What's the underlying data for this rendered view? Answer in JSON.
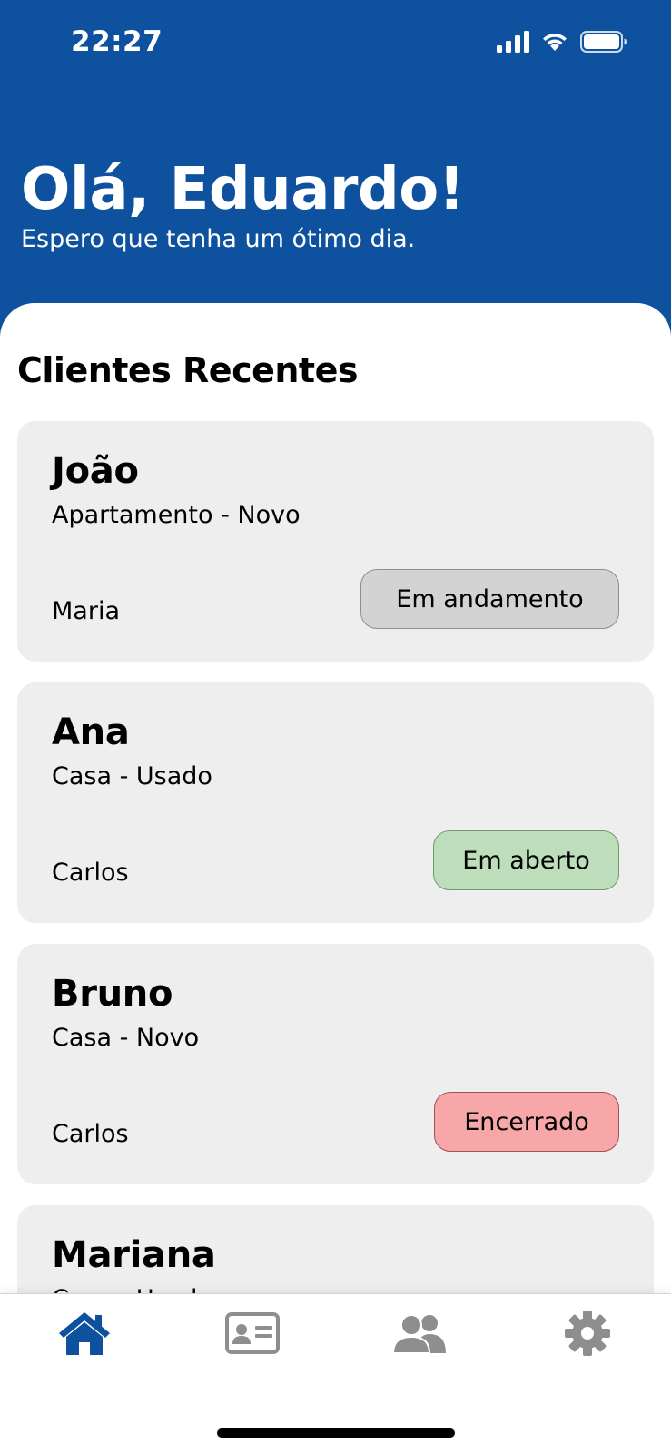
{
  "status_bar": {
    "time": "22:27"
  },
  "header": {
    "greeting": "Olá, Eduardo!",
    "subtitle": "Espero que tenha um ótimo dia."
  },
  "recent_clients": {
    "title": "Clientes Recentes",
    "items": [
      {
        "name": "João",
        "property": "Apartamento - Novo",
        "agent": "Maria",
        "status": "Em andamento"
      },
      {
        "name": "Ana",
        "property": "Casa - Usado",
        "agent": "Carlos",
        "status": "Em aberto"
      },
      {
        "name": "Bruno",
        "property": "Casa - Novo",
        "agent": "Carlos",
        "status": "Encerrado"
      },
      {
        "name": "Mariana",
        "property": "Casa - Usado",
        "agent": "",
        "status": ""
      }
    ]
  },
  "bottom_nav": {
    "items": [
      {
        "icon": "home-icon",
        "active": true
      },
      {
        "icon": "id-card-icon",
        "active": false
      },
      {
        "icon": "users-icon",
        "active": false
      },
      {
        "icon": "gear-icon",
        "active": false
      }
    ]
  },
  "colors": {
    "brand_blue": "#0E519E",
    "card_bg": "#EEEEEE",
    "status_in_progress": "#D3D3D3",
    "status_open": "#BDDDBB",
    "status_closed": "#F7A7A8",
    "nav_inactive": "#8E8E8E"
  }
}
